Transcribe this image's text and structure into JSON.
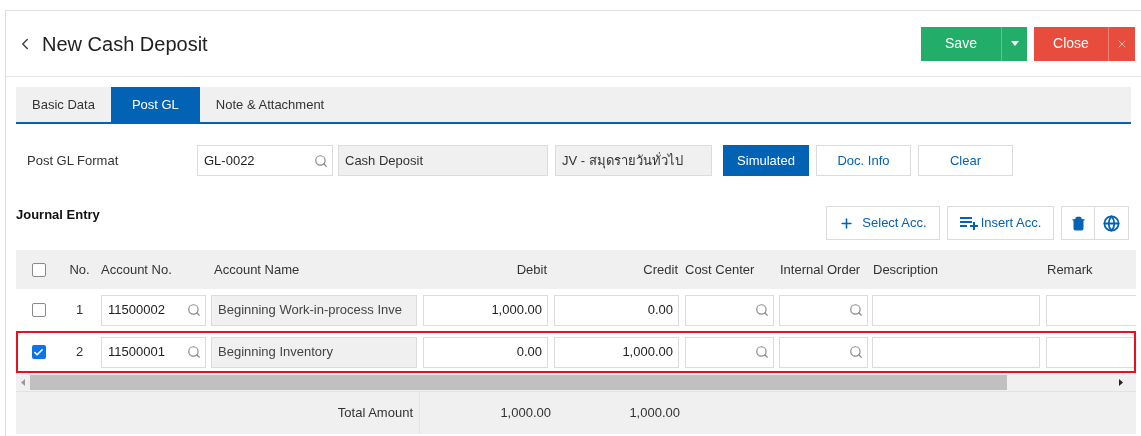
{
  "header": {
    "title": "New Cash Deposit",
    "save": "Save",
    "close": "Close"
  },
  "tabs": [
    {
      "label": "Basic Data",
      "selected": false
    },
    {
      "label": "Post GL",
      "selected": true
    },
    {
      "label": "Note & Attachment",
      "selected": false
    }
  ],
  "post_gl": {
    "label": "Post GL Format",
    "code": "GL-0022",
    "name": "Cash Deposit",
    "journal": "JV - สมุดรายวันทั่วไป",
    "buttons": [
      {
        "label": "Simulated",
        "selected": true
      },
      {
        "label": "Doc. Info",
        "selected": false
      },
      {
        "label": "Clear",
        "selected": false
      }
    ]
  },
  "journal": {
    "title": "Journal Entry",
    "select_acc": "Select Acc.",
    "insert_acc": "Insert Acc.",
    "columns": [
      "No.",
      "Account No.",
      "Account Name",
      "Debit",
      "Credit",
      "Cost Center",
      "Internal Order",
      "Description",
      "Remark"
    ],
    "all_checked": false,
    "rows": [
      {
        "checked": false,
        "highlighted": false,
        "no": "1",
        "account_no": "11500002",
        "account_name": "Beginning Work-in-process Inve",
        "debit": "1,000.00",
        "credit": "0.00"
      },
      {
        "checked": true,
        "highlighted": true,
        "no": "2",
        "account_no": "11500001",
        "account_name": "Beginning Inventory",
        "debit": "0.00",
        "credit": "1,000.00"
      }
    ],
    "total": {
      "label": "Total Amount",
      "debit": "1,000.00",
      "credit": "1,000.00"
    }
  }
}
